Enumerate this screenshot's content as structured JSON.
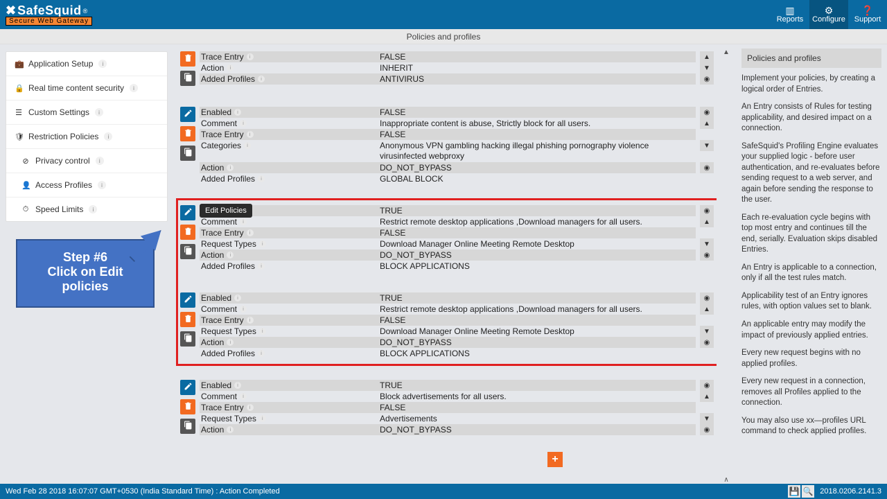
{
  "brand": {
    "name": "SafeSquid",
    "reg": "®",
    "tag": "Secure Web Gateway"
  },
  "header_actions": {
    "reports": "Reports",
    "configure": "Configure",
    "support": "Support"
  },
  "section_title": "Policies and profiles",
  "sidebar": {
    "items": [
      {
        "icon": "briefcase",
        "label": "Application Setup"
      },
      {
        "icon": "lock",
        "label": "Real time content security"
      },
      {
        "icon": "sliders",
        "label": "Custom Settings"
      },
      {
        "icon": "shield",
        "label": "Restriction Policies"
      }
    ],
    "subitems": [
      {
        "icon": "block",
        "label": "Privacy control"
      },
      {
        "icon": "profile",
        "label": "Access Profiles"
      },
      {
        "icon": "gauge",
        "label": "Speed Limits"
      }
    ]
  },
  "callout": {
    "l1": "Step #6",
    "l2": "Click on Edit",
    "l3": "policies"
  },
  "tooltip_edit": "Edit Policies",
  "entries": [
    {
      "partial_top": true,
      "rows": [
        {
          "label": "Trace Entry",
          "value": "FALSE"
        },
        {
          "label": "Action",
          "value": "INHERIT"
        },
        {
          "label": "Added Profiles",
          "value": "ANTIVIRUS"
        }
      ],
      "icons": [
        "del",
        "copy"
      ]
    },
    {
      "rows": [
        {
          "label": "Enabled",
          "value": "FALSE"
        },
        {
          "label": "Comment",
          "value": "Inappropriate content is abuse, Strictly block for all users."
        },
        {
          "label": "Trace Entry",
          "value": "FALSE"
        },
        {
          "label": "Categories",
          "value": "Anonymous VPN  gambling  hacking  illegal  phishing  pornography  violence  virusinfected  webproxy",
          "twoLine": true
        },
        {
          "label": "Action",
          "value": "DO_NOT_BYPASS"
        },
        {
          "label": "Added Profiles",
          "value": "GLOBAL BLOCK"
        }
      ],
      "icons": [
        "edit",
        "del",
        "copy"
      ]
    },
    {
      "hl": true,
      "tooltip": true,
      "rows": [
        {
          "label": "Enabled",
          "value": "TRUE",
          "label_hidden": true
        },
        {
          "label": "Comment",
          "value": "Restrict remote desktop applications ,Download managers for all users."
        },
        {
          "label": "Trace Entry",
          "value": "FALSE"
        },
        {
          "label": "Request Types",
          "value": "Download Manager  Online Meeting  Remote Desktop"
        },
        {
          "label": "Action",
          "value": "DO_NOT_BYPASS"
        },
        {
          "label": "Added Profiles",
          "value": "BLOCK APPLICATIONS"
        }
      ],
      "icons": [
        "edit",
        "del",
        "copy"
      ]
    },
    {
      "rows": [
        {
          "label": "Enabled",
          "value": "TRUE"
        },
        {
          "label": "Comment",
          "value": "Restrict remote desktop applications ,Download managers for all users."
        },
        {
          "label": "Trace Entry",
          "value": "FALSE"
        },
        {
          "label": "Request Types",
          "value": "Download Manager  Online Meeting  Remote Desktop"
        },
        {
          "label": "Action",
          "value": "DO_NOT_BYPASS"
        },
        {
          "label": "Added Profiles",
          "value": "BLOCK APPLICATIONS"
        }
      ],
      "icons": [
        "edit",
        "del",
        "copy"
      ]
    },
    {
      "partial_bottom": true,
      "rows": [
        {
          "label": "Enabled",
          "value": "TRUE"
        },
        {
          "label": "Comment",
          "value": "Block advertisements for all users."
        },
        {
          "label": "Trace Entry",
          "value": "FALSE"
        },
        {
          "label": "Request Types",
          "value": "Advertisements"
        },
        {
          "label": "Action",
          "value": "DO_NOT_BYPASS"
        }
      ],
      "icons": [
        "edit",
        "del",
        "copy"
      ]
    }
  ],
  "righthelp": {
    "title": "Policies and profiles",
    "paras": [
      "Implement your policies, by creating a logical order of Entries.",
      "An Entry consists of Rules for testing applicability, and desired impact on a connection.",
      "SafeSquid's Profiling Engine evaluates your supplied logic - before user authentication, and re-evaluates before sending request to a web server, and again before sending the response to the user.",
      "Each re-evaluation cycle begins with top most entry and continues till the end, serially. Evaluation skips disabled Entries.",
      "An Entry is applicable to a connection, only if all the test rules match.",
      "Applicability test of an Entry ignores rules, with option values set to blank.",
      "An applicable entry may modify the impact of previously applied entries.",
      "Every new request begins with no applied profiles.",
      "Every new request in a connection, removes all Profiles applied to the connection.",
      "You may also use xx—profiles URL command to check applied profiles."
    ]
  },
  "footer": {
    "status": "Wed Feb 28 2018 16:07:07 GMT+0530 (India Standard Time) : Action Completed",
    "version": "2018.0206.2141.3"
  }
}
